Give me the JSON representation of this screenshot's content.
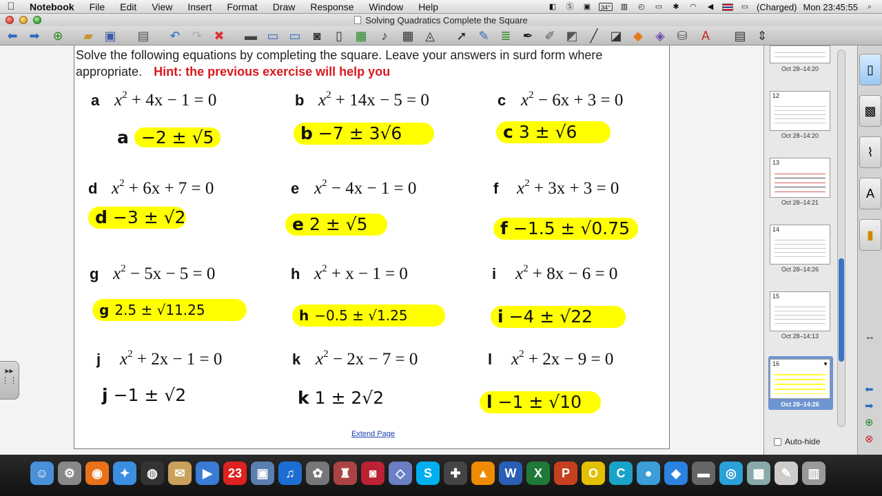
{
  "menubar": {
    "apple": "",
    "app_name": "Notebook",
    "items": [
      "File",
      "Edit",
      "View",
      "Insert",
      "Format",
      "Draw",
      "Response",
      "Window",
      "Help"
    ],
    "temperature": "34°",
    "battery": "(Charged)",
    "clock": "Mon 23:45:55"
  },
  "window": {
    "title": "Solving Quadratics Complete the Square"
  },
  "page": {
    "instructions": "Solve the following equations by completing the square. Leave your answers in surd form where appropriate.",
    "hint": "Hint:  the previous exercise will help you",
    "extend_link": "Extend Page",
    "problems": [
      {
        "letter": "a",
        "terms": [
          "x",
          "2",
          " + 4x − 1 = 0"
        ]
      },
      {
        "letter": "b",
        "terms": [
          "x",
          "2",
          " + 14x − 5 = 0"
        ]
      },
      {
        "letter": "c",
        "terms": [
          "x",
          "2",
          " − 6x + 3 = 0"
        ]
      },
      {
        "letter": "d",
        "terms": [
          "x",
          "2",
          " + 6x + 7 = 0"
        ]
      },
      {
        "letter": "e",
        "terms": [
          "x",
          "2",
          " − 4x − 1 = 0"
        ]
      },
      {
        "letter": "f",
        "terms": [
          "x",
          "2",
          " + 3x + 3 = 0"
        ]
      },
      {
        "letter": "g",
        "terms": [
          "x",
          "2",
          " − 5x − 5 = 0"
        ]
      },
      {
        "letter": "h",
        "terms": [
          "x",
          "2",
          " + x − 1 = 0"
        ]
      },
      {
        "letter": "i",
        "terms": [
          "x",
          "2",
          " + 8x − 6 = 0"
        ]
      },
      {
        "letter": "j",
        "terms": [
          "x",
          "2",
          " + 2x − 1 = 0"
        ]
      },
      {
        "letter": "k",
        "terms": [
          "x",
          "2",
          " − 2x − 7 = 0"
        ]
      },
      {
        "letter": "l",
        "terms": [
          "x",
          "2",
          " + 2x − 9 = 0"
        ]
      }
    ],
    "answers": [
      {
        "letter": "a",
        "value": "−2 ± √5"
      },
      {
        "letter": "b",
        "value": "−7 ± 3√6"
      },
      {
        "letter": "c",
        "value": "3 ± √6"
      },
      {
        "letter": "d",
        "value": "−3 ± √2"
      },
      {
        "letter": "e",
        "value": "2 ± √5"
      },
      {
        "letter": "f",
        "value": "−1.5 ± √0.75"
      },
      {
        "letter": "g",
        "value": "2.5 ± √11.25"
      },
      {
        "letter": "h",
        "value": "−0.5 ± √1.25"
      },
      {
        "letter": "i",
        "value": "−4 ± √22"
      },
      {
        "letter": "j",
        "value": "−1 ± √2"
      },
      {
        "letter": "k",
        "value": "1 ± 2√2"
      },
      {
        "letter": "l",
        "value": "−1 ± √10"
      }
    ],
    "highlight_color": "#ffff00",
    "hint_color": "#d71920"
  },
  "sidebar": {
    "thumbnails": [
      {
        "number": "",
        "label": "Oct 28–14:20"
      },
      {
        "number": "12",
        "label": "Oct 28–14:20"
      },
      {
        "number": "13",
        "label": "Oct 28–14:21"
      },
      {
        "number": "14",
        "label": "Oct 28–14:26"
      },
      {
        "number": "15",
        "label": "Oct 28–14:13"
      },
      {
        "number": "16",
        "label": "Oct 28–14:26"
      }
    ],
    "selected_index": 5,
    "autohide_label": "Auto-hide"
  },
  "dock": {
    "icons": [
      "finder-icon",
      "system-preferences-icon",
      "firefox-icon",
      "safari-icon",
      "dashboard-icon",
      "mail-icon",
      "facetime-icon",
      "ical-icon",
      "iphoto-icon",
      "itunes-icon",
      "image-capture-icon",
      "chess-icon",
      "photo-booth-icon",
      "geogebra-icon",
      "skype-icon",
      "x11-icon",
      "vlc-icon",
      "word-icon",
      "excel-icon",
      "powerpoint-icon",
      "outlook-icon",
      "calendar-icon",
      "messenger-icon",
      "dropbox-icon",
      "disk-utility-icon",
      "dvd-icon",
      "preview-icon",
      "textedit-icon",
      "trash-icon"
    ]
  }
}
